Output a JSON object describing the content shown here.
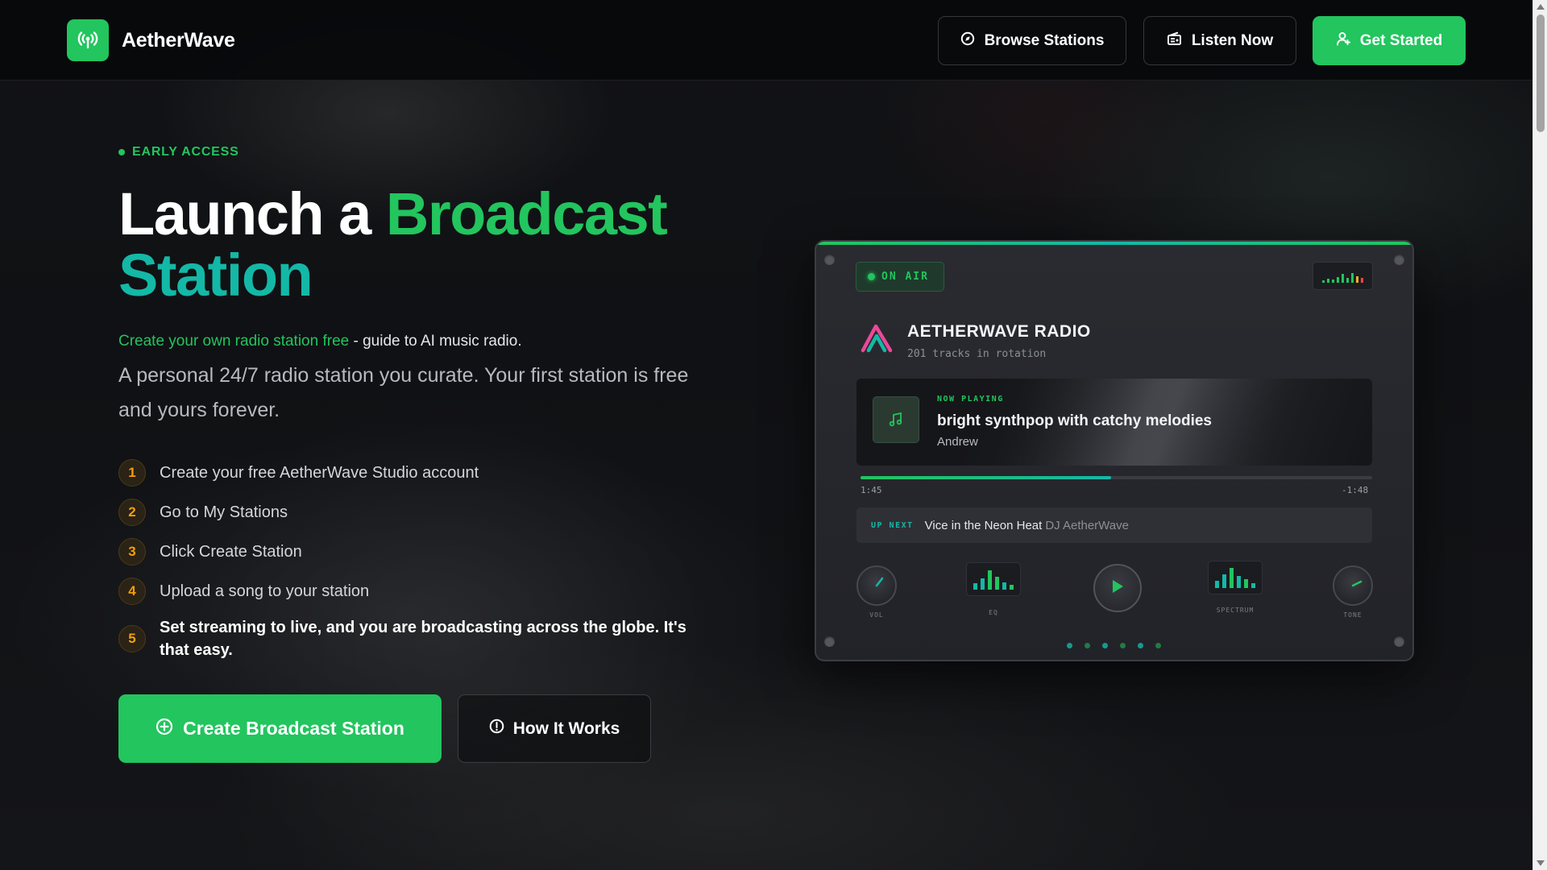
{
  "nav": {
    "brand": "AetherWave",
    "browse_label": "Browse Stations",
    "listen_label": "Listen Now",
    "start_label": "Get Started"
  },
  "hero": {
    "badge": "EARLY ACCESS",
    "title_part1": "Launch a ",
    "title_part2": "Broadcast",
    "title_part3": "Station",
    "lead_link": "Create your own radio station free",
    "lead_rest": " - guide to AI music radio.",
    "description": "A personal 24/7 radio station you curate. Your first station is free and yours forever.",
    "steps": [
      {
        "num": "1",
        "text": "Create your free AetherWave Studio account"
      },
      {
        "num": "2",
        "text": "Go to My Stations"
      },
      {
        "num": "3",
        "text": "Click Create Station"
      },
      {
        "num": "4",
        "text": "Upload a song to your station"
      },
      {
        "num": "5",
        "text": "Set streaming to live, and you are broadcasting across the globe. It's that easy."
      }
    ],
    "cta_primary": "Create Broadcast Station",
    "cta_secondary": "How It Works"
  },
  "radio": {
    "on_air": "ON AIR",
    "station_name": "AETHERWAVE RADIO",
    "station_sub": "201 tracks in rotation",
    "now_playing_label": "NOW PLAYING",
    "track_title": "bright synthpop with catchy melodies",
    "track_artist": "Andrew",
    "progress": 0.49,
    "time_elapsed": "1:45",
    "time_remaining": "-1:48",
    "upnext_label": "UP NEXT",
    "upnext_title": "Vice in the Neon Heat",
    "upnext_artist": "DJ AetherWave",
    "controls": {
      "vol": "VOL",
      "eq": "EQ",
      "spectrum": "SPECTRUM",
      "tone": "TONE"
    }
  },
  "colors": {
    "accent_green": "#22c55e",
    "accent_teal": "#14b8a6",
    "step_amber": "#f59e0b"
  },
  "icons": {
    "brand": "radio-antenna-icon",
    "browse": "compass-icon",
    "listen": "radio-icon",
    "start": "user-icon",
    "cta_primary": "plus-circle-icon",
    "cta_secondary": "info-circle-icon",
    "track_art": "music-note-icon",
    "play": "play-icon"
  }
}
